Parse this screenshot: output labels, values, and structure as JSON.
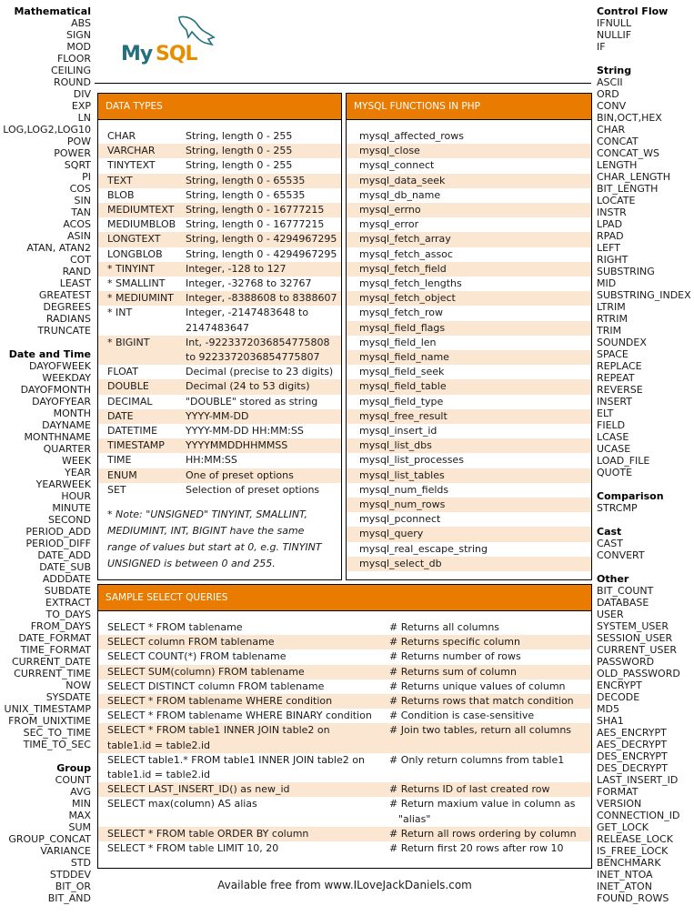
{
  "left_sidebar": [
    {
      "heading": "Mathematical",
      "items": [
        "ABS",
        "SIGN",
        "MOD",
        "FLOOR",
        "CEILING",
        "ROUND",
        "DIV",
        "EXP",
        "LN",
        "LOG,LOG2,LOG10",
        "POW",
        "POWER",
        "SQRT",
        "PI",
        "COS",
        "SIN",
        "TAN",
        "ACOS",
        "ASIN",
        "ATAN, ATAN2",
        "COT",
        "RAND",
        "LEAST",
        "GREATEST",
        "DEGREES",
        "RADIANS",
        "TRUNCATE"
      ]
    },
    {
      "heading": "Date and Time",
      "items": [
        "DAYOFWEEK",
        "WEEKDAY",
        "DAYOFMONTH",
        "DAYOFYEAR",
        "MONTH",
        "DAYNAME",
        "MONTHNAME",
        "QUARTER",
        "WEEK",
        "YEAR",
        "YEARWEEK",
        "HOUR",
        "MINUTE",
        "SECOND",
        "PERIOD_ADD",
        "PERIOD_DIFF",
        "DATE_ADD",
        "DATE_SUB",
        "ADDDATE",
        "SUBDATE",
        "EXTRACT",
        "TO_DAYS",
        "FROM_DAYS",
        "DATE_FORMAT",
        "TIME_FORMAT",
        "CURRENT_DATE",
        "CURRENT_TIME",
        "NOW",
        "SYSDATE",
        "UNIX_TIMESTAMP",
        "FROM_UNIXTIME",
        "SEC_TO_TIME",
        "TIME_TO_SEC"
      ]
    },
    {
      "heading": "Group",
      "items": [
        "COUNT",
        "AVG",
        "MIN",
        "MAX",
        "SUM",
        "GROUP_CONCAT",
        "VARIANCE",
        "STD",
        "STDDEV",
        "BIT_OR",
        "BIT_AND"
      ]
    }
  ],
  "right_sidebar": [
    {
      "heading": "Control Flow",
      "items": [
        "IFNULL",
        "NULLIF",
        "IF"
      ]
    },
    {
      "heading": "String",
      "items": [
        "ASCII",
        "ORD",
        "CONV",
        "BIN,OCT,HEX",
        "CHAR",
        "CONCAT",
        "CONCAT_WS",
        "LENGTH",
        "CHAR_LENGTH",
        "BIT_LENGTH",
        "LOCATE",
        "INSTR",
        "LPAD",
        "RPAD",
        "LEFT",
        "RIGHT",
        "SUBSTRING",
        "MID",
        "SUBSTRING_INDEX",
        "LTRIM",
        "RTRIM",
        "TRIM",
        "SOUNDEX",
        "SPACE",
        "REPLACE",
        "REPEAT",
        "REVERSE",
        "INSERT",
        "ELT",
        "FIELD",
        "LCASE",
        "UCASE",
        "LOAD_FILE",
        "QUOTE"
      ]
    },
    {
      "heading": "Comparison",
      "items": [
        "STRCMP"
      ]
    },
    {
      "heading": "Cast",
      "items": [
        "CAST",
        "CONVERT"
      ]
    },
    {
      "heading": "Other",
      "items": [
        "BIT_COUNT",
        "DATABASE",
        "USER",
        "SYSTEM_USER",
        "SESSION_USER",
        "CURRENT_USER",
        "PASSWORD",
        "OLD_PASSWORD",
        "ENCRYPT",
        "DECODE",
        "MD5",
        "SHA1",
        "AES_ENCRYPT",
        "AES_DECRYPT",
        "DES_ENCRYPT",
        "DES_DECRYPT",
        "LAST_INSERT_ID",
        "FORMAT",
        "VERSION",
        "CONNECTION_ID",
        "GET_LOCK",
        "RELEASE_LOCK",
        "IS_FREE_LOCK",
        "BENCHMARK",
        "INET_NTOA",
        "INET_ATON",
        "FOUND_ROWS"
      ]
    }
  ],
  "logo": {
    "my": "My",
    "sql": "SQL",
    "brand_teal": "#24707f",
    "brand_orange": "#e48e00"
  },
  "data_types": {
    "title": "DATA TYPES",
    "rows": [
      {
        "type": "CHAR",
        "desc": [
          "String, length 0 - 255"
        ]
      },
      {
        "type": "VARCHAR",
        "desc": [
          "String, length 0 - 255"
        ]
      },
      {
        "type": "TINYTEXT",
        "desc": [
          "String, length 0 - 255"
        ]
      },
      {
        "type": "TEXT",
        "desc": [
          "String, length 0 - 65535"
        ]
      },
      {
        "type": "BLOB",
        "desc": [
          "String, length 0 - 65535"
        ]
      },
      {
        "type": "MEDIUMTEXT",
        "desc": [
          "String, length 0 - 16777215"
        ]
      },
      {
        "type": "MEDIUMBLOB",
        "desc": [
          "String, length 0 - 16777215"
        ]
      },
      {
        "type": "LONGTEXT",
        "desc": [
          "String, length 0 - 4294967295"
        ]
      },
      {
        "type": "LONGBLOB",
        "desc": [
          "String, length 0 - 4294967295"
        ]
      },
      {
        "type": "* TINYINT",
        "desc": [
          "Integer, -128 to 127"
        ]
      },
      {
        "type": "* SMALLINT",
        "desc": [
          "Integer, -32768 to 32767"
        ]
      },
      {
        "type": "* MEDIUMINT",
        "desc": [
          "Integer, -8388608 to 8388607"
        ]
      },
      {
        "type": "* INT",
        "desc": [
          "Integer, -2147483648 to",
          "2147483647"
        ]
      },
      {
        "type": "* BIGINT",
        "desc": [
          "Int, -9223372036854775808",
          "to 9223372036854775807"
        ]
      },
      {
        "type": "FLOAT",
        "desc": [
          "Decimal (precise to 23 digits)"
        ]
      },
      {
        "type": "DOUBLE",
        "desc": [
          "Decimal (24 to 53 digits)"
        ]
      },
      {
        "type": "DECIMAL",
        "desc": [
          "\"DOUBLE\" stored as string"
        ]
      },
      {
        "type": "DATE",
        "desc": [
          "YYYY-MM-DD"
        ]
      },
      {
        "type": "DATETIME",
        "desc": [
          "YYYY-MM-DD HH:MM:SS"
        ]
      },
      {
        "type": "TIMESTAMP",
        "desc": [
          "YYYYMMDDHHMMSS"
        ]
      },
      {
        "type": "TIME",
        "desc": [
          "HH:MM:SS"
        ]
      },
      {
        "type": "ENUM",
        "desc": [
          "One of preset options"
        ]
      },
      {
        "type": "SET",
        "desc": [
          "Selection of preset options"
        ]
      }
    ],
    "note": "* Note: \"UNSIGNED\" TINYINT, SMALLINT, MEDIUMINT, INT, BIGINT have the same range of values but start at 0, e.g. TINYINT UNSIGNED is between 0 and 255."
  },
  "php_functions": {
    "title": "MYSQL FUNCTIONS IN PHP",
    "items": [
      "mysql_affected_rows",
      "mysql_close",
      "mysql_connect",
      "mysql_data_seek",
      "mysql_db_name",
      "mysql_errno",
      "mysql_error",
      "mysql_fetch_array",
      "mysql_fetch_assoc",
      "mysql_fetch_field",
      "mysql_fetch_lengths",
      "mysql_fetch_object",
      "mysql_fetch_row",
      "mysql_field_flags",
      "mysql_field_len",
      "mysql_field_name",
      "mysql_field_seek",
      "mysql_field_table",
      "mysql_field_type",
      "mysql_free_result",
      "mysql_insert_id",
      "mysql_list_dbs",
      "mysql_list_processes",
      "mysql_list_tables",
      "mysql_num_fields",
      "mysql_num_rows",
      "mysql_pconnect",
      "mysql_query",
      "mysql_real_escape_string",
      "mysql_select_db"
    ]
  },
  "sample_queries": {
    "title": "SAMPLE SELECT QUERIES",
    "rows": [
      {
        "sql": [
          "SELECT * FROM tablename"
        ],
        "comment": [
          "# Returns all columns"
        ]
      },
      {
        "sql": [
          "SELECT column FROM tablename"
        ],
        "comment": [
          "# Returns specific column"
        ]
      },
      {
        "sql": [
          "SELECT COUNT(*) FROM tablename"
        ],
        "comment": [
          "# Returns number of rows"
        ]
      },
      {
        "sql": [
          "SELECT SUM(column) FROM tablename"
        ],
        "comment": [
          "# Returns sum of column"
        ]
      },
      {
        "sql": [
          "SELECT DISTINCT column FROM tablename"
        ],
        "comment": [
          "# Returns unique values of column"
        ]
      },
      {
        "sql": [
          "SELECT * FROM tablename WHERE condition"
        ],
        "comment": [
          "# Returns rows that match condition"
        ]
      },
      {
        "sql": [
          "SELECT * FROM tablename WHERE BINARY condition"
        ],
        "comment": [
          "# Condition is case-sensitive"
        ]
      },
      {
        "sql": [
          "SELECT * FROM table1 INNER JOIN table2 on",
          "table1.id = table2.id"
        ],
        "comment": [
          "# Join two tables, return all columns"
        ]
      },
      {
        "sql": [
          "SELECT table1.* FROM table1 INNER JOIN table2 on",
          "table1.id = table2.id"
        ],
        "comment": [
          "# Only return columns from table1"
        ]
      },
      {
        "sql": [
          "SELECT LAST_INSERT_ID() as new_id"
        ],
        "comment": [
          "# Returns ID of last created row"
        ]
      },
      {
        "sql": [
          "SELECT max(column) AS alias"
        ],
        "comment": [
          "# Return maxium value in column as",
          "\"alias\""
        ]
      },
      {
        "sql": [
          "SELECT * FROM table ORDER BY column"
        ],
        "comment": [
          "# Return all rows ordering by column"
        ]
      },
      {
        "sql": [
          "SELECT * FROM table LIMIT 10, 20"
        ],
        "comment": [
          "# Return first 20 rows after row 10"
        ]
      }
    ]
  },
  "footer": "Available free from www.ILoveJackDaniels.com",
  "colors": {
    "header_orange": "#e87b00",
    "row_highlight": "#fbe6d2"
  }
}
